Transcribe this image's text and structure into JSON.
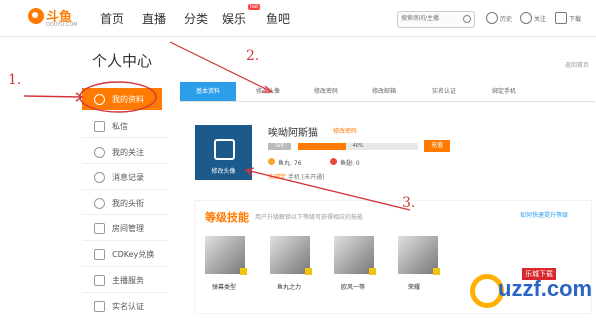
{
  "header": {
    "logo_text": "斗鱼",
    "logo_sub": "DOUYU.COM",
    "nav": [
      "首页",
      "直播",
      "分类",
      "娱乐",
      "鱼吧"
    ],
    "nav_hot": "hot",
    "search_placeholder": "搜索房间/主播",
    "icons": [
      {
        "name": "history-icon",
        "label": "历史"
      },
      {
        "name": "follow-icon",
        "label": "关注"
      },
      {
        "name": "download-icon",
        "label": "下载"
      }
    ]
  },
  "sidebar": {
    "title": "个人中心",
    "items": [
      {
        "label": "我的资料",
        "active": true
      },
      {
        "label": "私信"
      },
      {
        "label": "我的关注"
      },
      {
        "label": "消息记录"
      },
      {
        "label": "我的头衔"
      },
      {
        "label": "房间管理"
      },
      {
        "label": "CDKey兑换"
      },
      {
        "label": "主播服务"
      },
      {
        "label": "实名认证"
      }
    ]
  },
  "tabs": [
    "基本资料",
    "修改头像",
    "修改密码",
    "修改邮箱",
    "实名认证",
    "绑定手机"
  ],
  "corner_link": "返回首页",
  "profile": {
    "avatar_label": "修改头像",
    "username": "唉呦阿斯猫",
    "edit_password": "修改密码",
    "level": "LV4",
    "progress_pct": 40,
    "progress_text": "40%",
    "charge_button": "充值",
    "fish_balls_label": "鱼丸: 76",
    "fish_chips_label": "鱼翅: 0",
    "phone_key": "未绑定",
    "phone_rest": "手机 [未开通]"
  },
  "skills": {
    "title": "等级技能",
    "desc": "用户升级解锁以下等级可获得相应的技能",
    "link": "如何快速提升等级",
    "items": [
      {
        "label": "弹幕类型"
      },
      {
        "label": "鱼丸之力"
      },
      {
        "label": "欧风一等"
      },
      {
        "label": "荣耀"
      }
    ]
  },
  "annotations": [
    "1.",
    "2.",
    "3."
  ],
  "watermark": {
    "tag": "乐城下载",
    "text": "uzzf.com"
  },
  "colors": {
    "accent": "#ff7a00",
    "tab_active": "#2b9de9",
    "annotation": "#d6343b"
  }
}
